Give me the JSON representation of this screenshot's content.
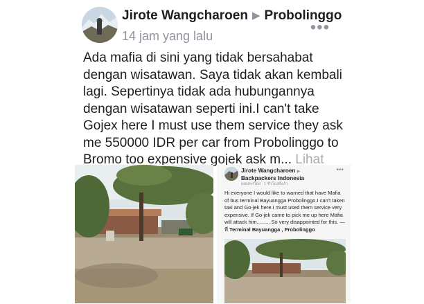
{
  "post": {
    "author": "Jirote Wangcharoen",
    "location": "Probolinggo",
    "time": "14 jam yang lalu",
    "text": "Ada mafia di sini yang tidak bersahabat dengan wisatawan. Saya tidak akan kembali lagi. Sepertinya tidak ada hubungannya dengan wisatawan seperti ini.I can't take Gojex here I must use them service they ask me 550000 IDR per car from Probolinggo to Bromo too expensive gojek ask m...",
    "see_more": "Lihat Selengkapnya"
  },
  "embedded_post": {
    "author": "Jirote Wangcharoen",
    "group": "Backpackers Indonesia",
    "time": "เผยแพร่โดย · 1 ชั่วโมงที่แล้ว ·",
    "text": "Hi everyone I would like to warned that have Mafia of bus terminal Bayuangga Probolinggo.I can't taken taxi and Go-jek here.I must used them service very expensive. If Go-jek came to pick me up here Mafia will attack him......... So very disappointed for this. — ที่",
    "place": "Terminal Bayuangga , Probolinggo"
  },
  "icons": {
    "more": "more-options-icon",
    "arrow": "arrow-right-icon",
    "avatar": "profile-avatar"
  }
}
